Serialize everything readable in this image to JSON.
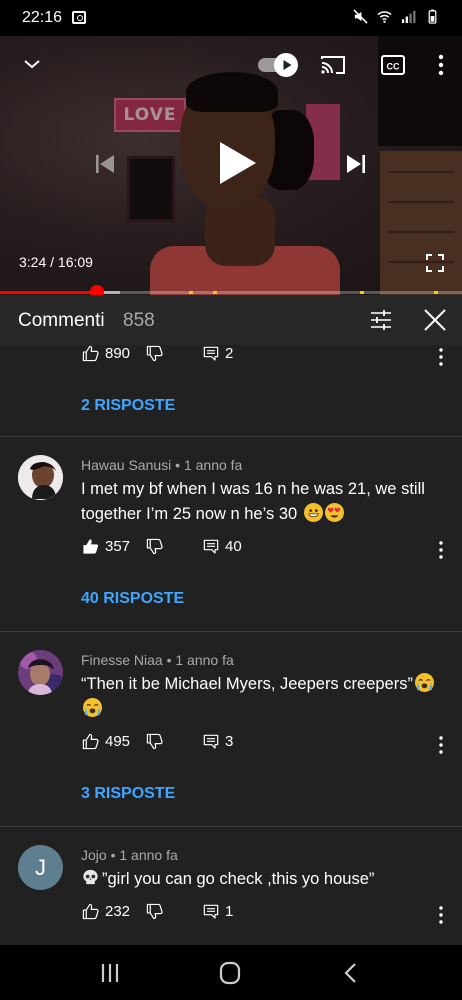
{
  "status_bar": {
    "time": "22:16",
    "icons": [
      "photo-notification-icon",
      "mute-icon",
      "wifi-icon",
      "signal-icon",
      "battery-icon"
    ]
  },
  "player": {
    "current_time": "3:24",
    "separator": "/",
    "duration": "16:09",
    "time_text": "3:24 / 16:09",
    "progress_fraction": 0.21,
    "buffer_fraction": 0.26,
    "ad_marker_fractions": [
      0.41,
      0.46,
      0.78,
      0.94
    ],
    "autoplay_on": true,
    "accent": "#ff0000",
    "scene": {
      "sign_text": "LOVE"
    }
  },
  "comments_panel": {
    "title": "Commenti",
    "count": "858",
    "link_color": "#3ea6ff"
  },
  "comments": [
    {
      "partial": true,
      "likes": "890",
      "replies_count": "2",
      "replies_link": "2 RISPOSTE"
    },
    {
      "author": "Hawau Sanusi",
      "time": "1 anno fa",
      "meta": "Hawau Sanusi • 1 anno fa",
      "text": "I met my bf when I was 16 n he was 21, we still together I’m 25 now n he’s 30",
      "emojis": [
        "grin-emoji",
        "heart-eyes-emoji"
      ],
      "likes": "357",
      "liked": true,
      "replies_count": "40",
      "replies_link": "40 RISPOSTE"
    },
    {
      "author": "Finesse Niaa",
      "time": "1 anno fa",
      "meta": "Finesse Niaa • 1 anno fa",
      "text": "“Then it be Michael Myers, Jeepers creepers”",
      "emojis": [
        "loudly-crying-emoji",
        "loudly-crying-emoji"
      ],
      "likes": "495",
      "liked": false,
      "replies_count": "3",
      "replies_link": "3 RISPOSTE"
    },
    {
      "author": "Jojo",
      "time": "1 anno fa",
      "meta": "Jojo • 1 anno fa",
      "avatar_letter": "J",
      "avatar_color": "#5f7f90",
      "text": "”girl you can go check ,this yo house”",
      "leading_emoji": "skull-emoji",
      "likes": "232",
      "liked": false,
      "replies_count": "1"
    }
  ],
  "nav_bar": {
    "buttons": [
      "recents-button",
      "home-button",
      "back-button"
    ]
  }
}
